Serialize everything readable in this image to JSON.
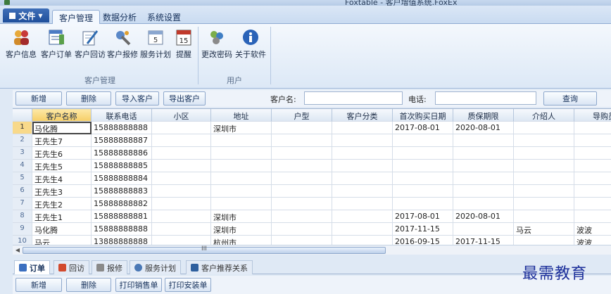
{
  "window": {
    "title": "Foxtable - 客户增值系统.FoxEx"
  },
  "ribbon": {
    "file_label": "文件",
    "tabs": [
      "客户管理",
      "数据分析",
      "系统设置"
    ],
    "buttons": [
      {
        "label": "客户信息",
        "icon": "users-icon"
      },
      {
        "label": "客户订单",
        "icon": "order-icon"
      },
      {
        "label": "客户回访",
        "icon": "edit-icon"
      },
      {
        "label": "客户报修",
        "icon": "repair-icon"
      },
      {
        "label": "服务计划",
        "icon": "calendar-icon"
      },
      {
        "label": "提醒",
        "icon": "reminder-icon"
      },
      {
        "label": "更改密码",
        "icon": "password-icon"
      },
      {
        "label": "关于软件",
        "icon": "info-icon"
      }
    ],
    "groups": [
      "客户管理",
      "用户"
    ]
  },
  "toolbar": {
    "add": "新增",
    "delete": "删除",
    "import": "导入客户",
    "export": "导出客户",
    "name_label": "客户名:",
    "name_value": "",
    "phone_label": "电话:",
    "phone_value": "",
    "search": "查询"
  },
  "grid": {
    "columns": [
      "客户名称",
      "联系电话",
      "小区",
      "地址",
      "户型",
      "客户分类",
      "首次购买日期",
      "质保期限",
      "介绍人",
      "导购员"
    ],
    "rows": [
      [
        "马化腾",
        "15888888888",
        "",
        "深圳市",
        "",
        "",
        "2017-08-01",
        "2020-08-01",
        "",
        ""
      ],
      [
        "王先生7",
        "15888888887",
        "",
        "",
        "",
        "",
        "",
        "",
        "",
        ""
      ],
      [
        "王先生6",
        "15888888886",
        "",
        "",
        "",
        "",
        "",
        "",
        "",
        ""
      ],
      [
        "王先生5",
        "15888888885",
        "",
        "",
        "",
        "",
        "",
        "",
        "",
        ""
      ],
      [
        "王先生4",
        "15888888884",
        "",
        "",
        "",
        "",
        "",
        "",
        "",
        ""
      ],
      [
        "王先生3",
        "15888888883",
        "",
        "",
        "",
        "",
        "",
        "",
        "",
        ""
      ],
      [
        "王先生2",
        "15888888882",
        "",
        "",
        "",
        "",
        "",
        "",
        "",
        ""
      ],
      [
        "王先生1",
        "15888888881",
        "",
        "深圳市",
        "",
        "",
        "2017-08-01",
        "2020-08-01",
        "",
        ""
      ],
      [
        "马化腾",
        "15888888888",
        "",
        "深圳市",
        "",
        "",
        "2017-11-15",
        "",
        "马云",
        "波波"
      ],
      [
        "马云",
        "13888888888",
        "",
        "杭州市",
        "",
        "",
        "2016-09-15",
        "2017-11-15",
        "",
        "波波"
      ]
    ]
  },
  "scroll_grip": "III",
  "bottom_tabs": [
    {
      "label": "订单",
      "icon": "order-icon",
      "color": "#3b6fc0"
    },
    {
      "label": "回访",
      "icon": "visit-icon",
      "color": "#d24a2e"
    },
    {
      "label": "报修",
      "icon": "repair-icon",
      "color": "#8a8a8a"
    },
    {
      "label": "服务计划",
      "icon": "clock-icon",
      "color": "#4a78b5"
    },
    {
      "label": "客户推荐关系",
      "icon": "relation-icon",
      "color": "#2e5f9e"
    }
  ],
  "bottom_toolbar": {
    "add": "新增",
    "delete": "删除",
    "print_sale": "打印销售单",
    "print_install": "打印安装单"
  },
  "watermark": "最需教育"
}
